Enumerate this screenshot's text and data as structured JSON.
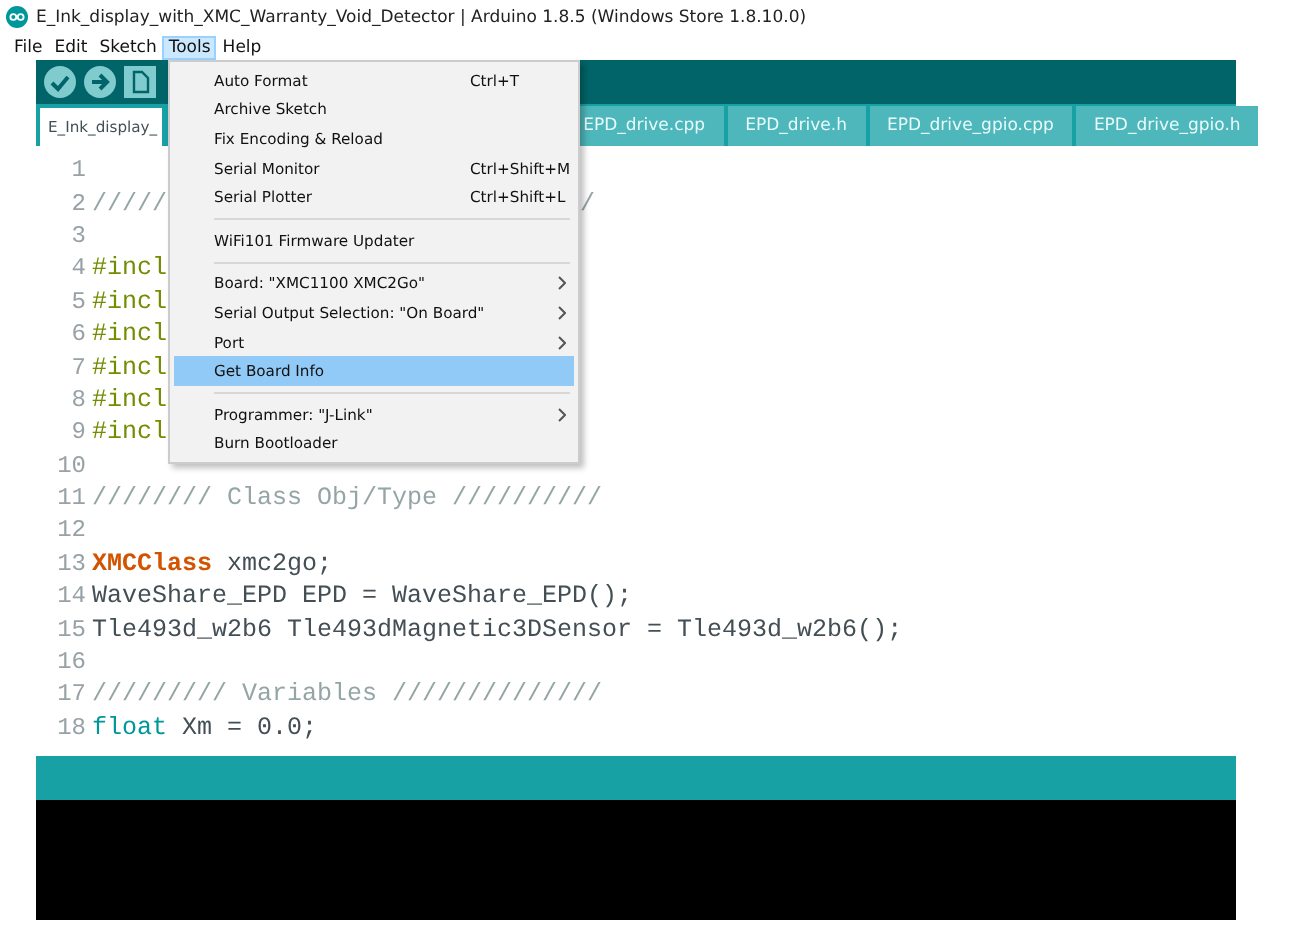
{
  "window": {
    "title": "E_Ink_display_with_XMC_Warranty_Void_Detector | Arduino 1.8.5 (Windows Store 1.8.10.0)"
  },
  "menubar": [
    {
      "label": "File",
      "selected": false
    },
    {
      "label": "Edit",
      "selected": false
    },
    {
      "label": "Sketch",
      "selected": false
    },
    {
      "label": "Tools",
      "selected": true
    },
    {
      "label": "Help",
      "selected": false
    }
  ],
  "tabs": [
    {
      "label": "E_Ink_display_",
      "selected": true
    },
    {
      "label": "EPD_drive.cpp",
      "selected": false
    },
    {
      "label": "EPD_drive.h",
      "selected": false
    },
    {
      "label": "EPD_drive_gpio.cpp",
      "selected": false
    },
    {
      "label": "EPD_drive_gpio.h",
      "selected": false
    }
  ],
  "code": [
    {
      "number": "1"
    },
    {
      "number": "2",
      "tokens": [
        {
          "text": "/////",
          "kind": "comment"
        }
      ],
      "tail": "/"
    },
    {
      "number": "3"
    },
    {
      "number": "4",
      "tokens": [
        {
          "text": "#incl",
          "kind": "directive"
        }
      ]
    },
    {
      "number": "5",
      "tokens": [
        {
          "text": "#incl",
          "kind": "directive"
        }
      ]
    },
    {
      "number": "6",
      "tokens": [
        {
          "text": "#incl",
          "kind": "directive"
        }
      ]
    },
    {
      "number": "7",
      "tokens": [
        {
          "text": "#incl",
          "kind": "directive"
        }
      ]
    },
    {
      "number": "8",
      "tokens": [
        {
          "text": "#incl",
          "kind": "directive"
        }
      ]
    },
    {
      "number": "9",
      "tokens": [
        {
          "text": "#incl",
          "kind": "directive"
        }
      ]
    },
    {
      "number": "10"
    },
    {
      "number": "11",
      "tokens": [
        {
          "text": "//////// Class Obj/Type //////////",
          "kind": "comment"
        }
      ]
    },
    {
      "number": "12"
    },
    {
      "number": "13",
      "tokens": [
        {
          "text": "XMCClass",
          "kind": "type"
        },
        {
          "text": " xmc2go;",
          "kind": "plain"
        }
      ]
    },
    {
      "number": "14",
      "tokens": [
        {
          "text": "WaveShare_EPD EPD = WaveShare_EPD();",
          "kind": "plain"
        }
      ]
    },
    {
      "number": "15",
      "tokens": [
        {
          "text": "Tle493d_w2b6 Tle493dMagnetic3DSensor = Tle493d_w2b6();",
          "kind": "plain"
        }
      ]
    },
    {
      "number": "16"
    },
    {
      "number": "17",
      "tokens": [
        {
          "text": "///////// Variables //////////////",
          "kind": "comment"
        }
      ]
    },
    {
      "number": "18",
      "tokens": [
        {
          "text": "float",
          "kind": "keyword"
        },
        {
          "text": " Xm = 0.0;",
          "kind": "plain"
        }
      ]
    }
  ],
  "tools_menu": [
    {
      "kind": "item",
      "label": "Auto Format",
      "shortcut": "Ctrl+T",
      "submenu": false,
      "selected": false
    },
    {
      "kind": "item",
      "label": "Archive Sketch",
      "submenu": false,
      "selected": false
    },
    {
      "kind": "item",
      "label": "Fix Encoding & Reload",
      "submenu": false,
      "selected": false
    },
    {
      "kind": "item",
      "label": "Serial Monitor",
      "shortcut": "Ctrl+Shift+M",
      "submenu": false,
      "selected": false
    },
    {
      "kind": "item",
      "label": "Serial Plotter",
      "shortcut": "Ctrl+Shift+L",
      "submenu": false,
      "selected": false
    },
    {
      "kind": "separator"
    },
    {
      "kind": "item",
      "label": "WiFi101 Firmware Updater",
      "submenu": false,
      "selected": false
    },
    {
      "kind": "separator"
    },
    {
      "kind": "item",
      "label": "Board: \"XMC1100 XMC2Go\"",
      "submenu": true,
      "selected": false
    },
    {
      "kind": "item",
      "label": "Serial Output Selection: \"On Board\"",
      "submenu": true,
      "selected": false
    },
    {
      "kind": "item",
      "label": "Port",
      "submenu": true,
      "selected": false
    },
    {
      "kind": "item",
      "label": "Get Board Info",
      "submenu": false,
      "selected": true
    },
    {
      "kind": "separator"
    },
    {
      "kind": "item",
      "label": "Programmer: \"J-Link\"",
      "submenu": true,
      "selected": false
    },
    {
      "kind": "item",
      "label": "Burn Bootloader",
      "submenu": false,
      "selected": false
    }
  ]
}
